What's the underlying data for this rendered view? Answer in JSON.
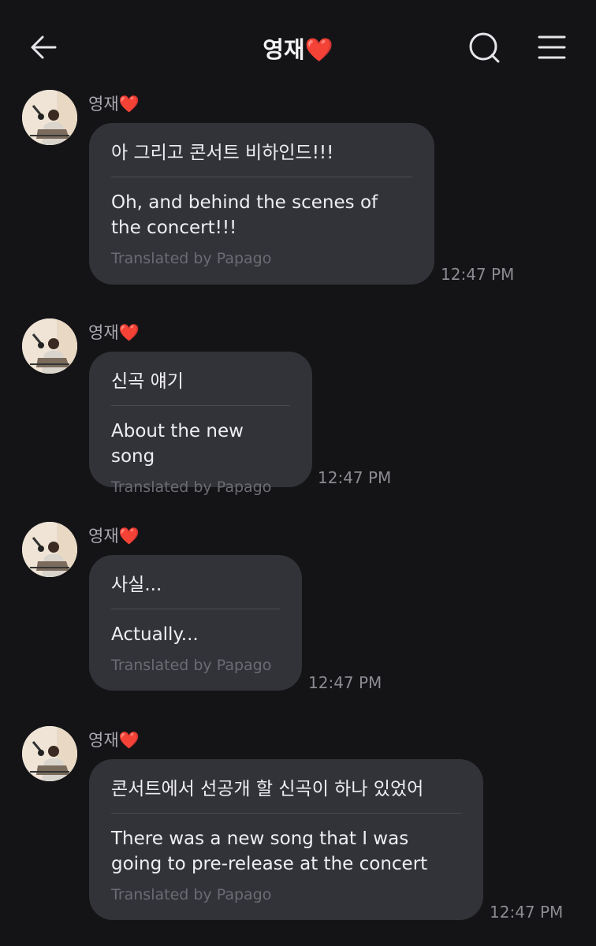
{
  "header": {
    "title": "영재",
    "title_emoji": "❤️",
    "back_icon": "back-arrow-icon",
    "search_icon": "search-icon",
    "menu_icon": "menu-icon"
  },
  "messages": [
    {
      "sender": "영재",
      "sender_emoji": "❤️",
      "original": "아 그리고 콘서트 비하인드!!!",
      "translation": "Oh, and behind the scenes of the concert!!!",
      "credit": "Translated by Papago",
      "time": "12:47 PM"
    },
    {
      "sender": "영재",
      "sender_emoji": "❤️",
      "original": "신곡 얘기",
      "translation": "About the new song",
      "credit": "Translated by Papago",
      "time": "12:47 PM"
    },
    {
      "sender": "영재",
      "sender_emoji": "❤️",
      "original": "사실...",
      "translation": "Actually...",
      "credit": "Translated by Papago",
      "time": "12:47 PM"
    },
    {
      "sender": "영재",
      "sender_emoji": "❤️",
      "original": "콘서트에서 선공개 할 신곡이 하나 있었어",
      "translation": "There was a new song that I was going to pre-release at the concert",
      "credit": "Translated by Papago",
      "time": "12:47 PM"
    }
  ],
  "colors": {
    "background": "#141417",
    "bubble": "#323338",
    "heart": "#e3202d",
    "muted": "#6b6c73"
  }
}
